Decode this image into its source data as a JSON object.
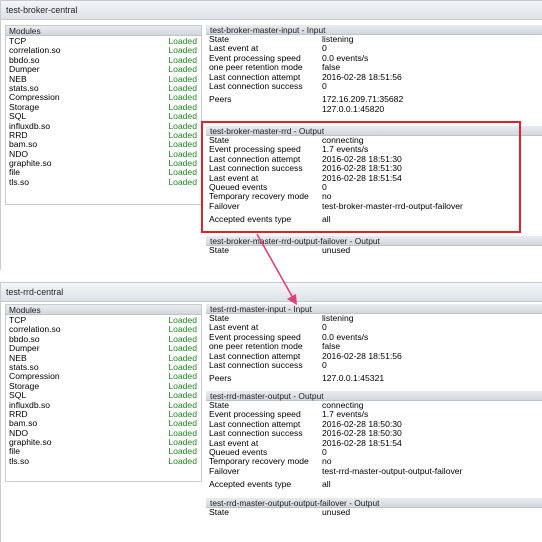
{
  "panels": [
    {
      "title": "test-broker-central",
      "modules_title": "Modules",
      "modules": [
        {
          "name": "TCP",
          "status": "Loaded"
        },
        {
          "name": "correlation.so",
          "status": "Loaded"
        },
        {
          "name": "bbdo.so",
          "status": "Loaded"
        },
        {
          "name": "Dumper",
          "status": "Loaded"
        },
        {
          "name": "NEB",
          "status": "Loaded"
        },
        {
          "name": "stats.so",
          "status": "Loaded"
        },
        {
          "name": "Compression",
          "status": "Loaded"
        },
        {
          "name": "Storage",
          "status": "Loaded"
        },
        {
          "name": "SQL",
          "status": "Loaded"
        },
        {
          "name": "influxdb.so",
          "status": "Loaded"
        },
        {
          "name": "RRD",
          "status": "Loaded"
        },
        {
          "name": "bam.so",
          "status": "Loaded"
        },
        {
          "name": "NDO",
          "status": "Loaded"
        },
        {
          "name": "graphite.so",
          "status": "Loaded"
        },
        {
          "name": "file",
          "status": "Loaded"
        },
        {
          "name": "tls.so",
          "status": "Loaded"
        }
      ],
      "sections": [
        {
          "title": "test-broker-master-input - Input",
          "rows": [
            {
              "k": "State",
              "v": "listening"
            },
            {
              "k": "Last event at",
              "v": "0"
            },
            {
              "k": "Event processing speed",
              "v": "0.0 events/s"
            },
            {
              "k": "one peer retention mode",
              "v": "false"
            },
            {
              "k": "Last connection attempt",
              "v": "2016-02-28 18:51:56"
            },
            {
              "k": "Last connection success",
              "v": "0"
            },
            {
              "k": "",
              "v": ""
            },
            {
              "k": "Peers",
              "v": "172.16.209.71:35682"
            },
            {
              "k": "",
              "v": "127.0.0.1:45820"
            }
          ]
        },
        {
          "title": "test-broker-master-rrd - Output",
          "rows": [
            {
              "k": "State",
              "v": "connecting"
            },
            {
              "k": "Event processing speed",
              "v": "1.7 events/s"
            },
            {
              "k": "Last connection attempt",
              "v": "2016-02-28 18:51:30"
            },
            {
              "k": "Last connection success",
              "v": "2016-02-28 18:51:30"
            },
            {
              "k": "Last event at",
              "v": "2016-02-28 18:51:54"
            },
            {
              "k": "Queued events",
              "v": "0"
            },
            {
              "k": "Temporary recovery mode",
              "v": "no"
            },
            {
              "k": "Failover",
              "v": "test-broker-master-rrd-output-failover"
            },
            {
              "k": "",
              "v": ""
            },
            {
              "k": "Accepted events type",
              "v": "all"
            }
          ]
        },
        {
          "title": "test-broker-master-rrd-output-failover - Output",
          "rows": [
            {
              "k": "State",
              "v": "unused"
            }
          ]
        }
      ]
    },
    {
      "title": "test-rrd-central",
      "modules_title": "Modules",
      "modules": [
        {
          "name": "TCP",
          "status": "Loaded"
        },
        {
          "name": "correlation.so",
          "status": "Loaded"
        },
        {
          "name": "bbdo.so",
          "status": "Loaded"
        },
        {
          "name": "Dumper",
          "status": "Loaded"
        },
        {
          "name": "NEB",
          "status": "Loaded"
        },
        {
          "name": "stats.so",
          "status": "Loaded"
        },
        {
          "name": "Compression",
          "status": "Loaded"
        },
        {
          "name": "Storage",
          "status": "Loaded"
        },
        {
          "name": "SQL",
          "status": "Loaded"
        },
        {
          "name": "influxdb.so",
          "status": "Loaded"
        },
        {
          "name": "RRD",
          "status": "Loaded"
        },
        {
          "name": "bam.so",
          "status": "Loaded"
        },
        {
          "name": "NDO",
          "status": "Loaded"
        },
        {
          "name": "graphite.so",
          "status": "Loaded"
        },
        {
          "name": "file",
          "status": "Loaded"
        },
        {
          "name": "tls.so",
          "status": "Loaded"
        }
      ],
      "sections": [
        {
          "title": "test-rrd-master-input - Input",
          "rows": [
            {
              "k": "State",
              "v": "listening"
            },
            {
              "k": "Last event at",
              "v": "0"
            },
            {
              "k": "Event processing speed",
              "v": "0.0 events/s"
            },
            {
              "k": "one peer retention mode",
              "v": "false"
            },
            {
              "k": "Last connection attempt",
              "v": "2016-02-28 18:51:56"
            },
            {
              "k": "Last connection success",
              "v": "0"
            },
            {
              "k": "",
              "v": ""
            },
            {
              "k": "Peers",
              "v": "127.0.0.1:45321"
            }
          ]
        },
        {
          "title": "test-rrd-master-output - Output",
          "rows": [
            {
              "k": "State",
              "v": "connecting"
            },
            {
              "k": "Event processing speed",
              "v": "1.7 events/s"
            },
            {
              "k": "Last connection attempt",
              "v": "2016-02-28 18:50:30"
            },
            {
              "k": "Last connection success",
              "v": "2016-02-28 18:50:30"
            },
            {
              "k": "Last event at",
              "v": "2016-02-28 18:51:54"
            },
            {
              "k": "Queued events",
              "v": "0"
            },
            {
              "k": "Temporary recovery mode",
              "v": "no"
            },
            {
              "k": "Failover",
              "v": "test-rrd-master-output-output-failover"
            },
            {
              "k": "",
              "v": ""
            },
            {
              "k": "Accepted events type",
              "v": "all"
            }
          ]
        },
        {
          "title": "test-rrd-master-output-output-failover - Output",
          "rows": [
            {
              "k": "State",
              "v": "unused"
            }
          ]
        }
      ]
    }
  ],
  "colors": {
    "highlight": "#e0202b",
    "arrow": "#e0407a",
    "loaded": "#1f8a1f"
  }
}
